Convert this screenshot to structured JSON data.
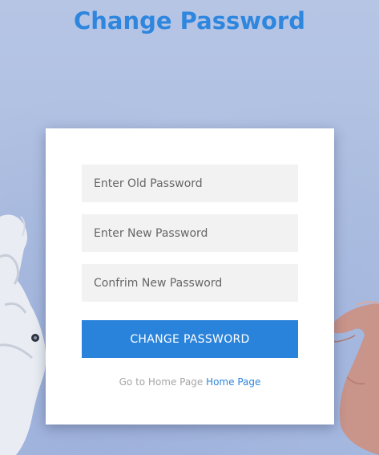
{
  "page": {
    "title": "Change Password"
  },
  "form": {
    "old_password_placeholder": "Enter Old Password",
    "new_password_placeholder": "Enter New Password",
    "confirm_password_placeholder": "Confrim New Password",
    "submit_label": "CHANGE PASSWORD"
  },
  "footer": {
    "prefix": "Go to Home Page",
    "link_label": "Home Page"
  },
  "colors": {
    "accent": "#2e86de",
    "button": "#2a83db",
    "field_bg": "#f2f2f2",
    "card_bg": "#ffffff"
  },
  "icons": {
    "background_left": "robot-hand-icon",
    "background_right": "human-hand-icon"
  }
}
